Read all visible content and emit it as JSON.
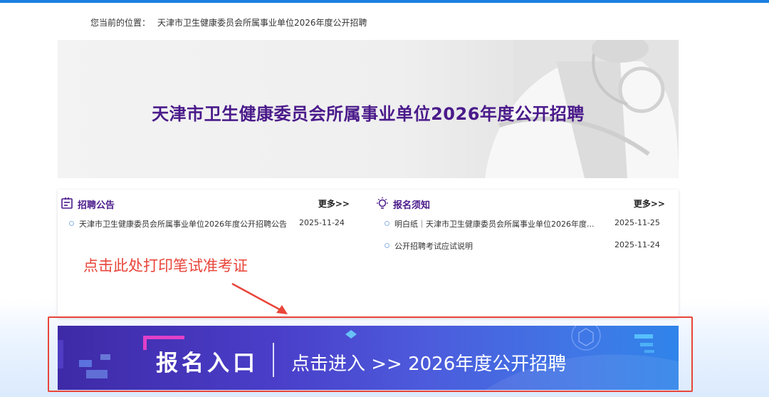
{
  "breadcrumb": {
    "label": "您当前的位置：",
    "current": "天津市卫生健康委员会所属事业单位2026年度公开招聘"
  },
  "banner": {
    "title": "天津市卫生健康委员会所属事业单位2026年度公开招聘"
  },
  "announcements": {
    "title": "招聘公告",
    "more": "更多>>",
    "icon": "notice-board-icon",
    "items": [
      {
        "title": "天津市卫生健康委员会所属事业单位2026年度公开招聘公告",
        "date": "2025-11-24"
      }
    ]
  },
  "notices": {
    "title": "报名须知",
    "more": "更多>>",
    "icon": "lightbulb-icon",
    "items": [
      {
        "title": "明白纸｜天津市卫生健康委员会所属事业单位2026年度...",
        "date": "2025-11-25"
      },
      {
        "title": "公开招聘考试应试说明",
        "date": "2025-11-24"
      }
    ]
  },
  "annotation": {
    "text": "点击此处打印笔试准考证"
  },
  "entry": {
    "label": "报名入口",
    "subtitle": "点击进入 >> 2026年度公开招聘"
  },
  "colors": {
    "accent_purple": "#4a1a8a",
    "top_bar": "#1b7fe0",
    "annotation_red": "#e8453a"
  }
}
